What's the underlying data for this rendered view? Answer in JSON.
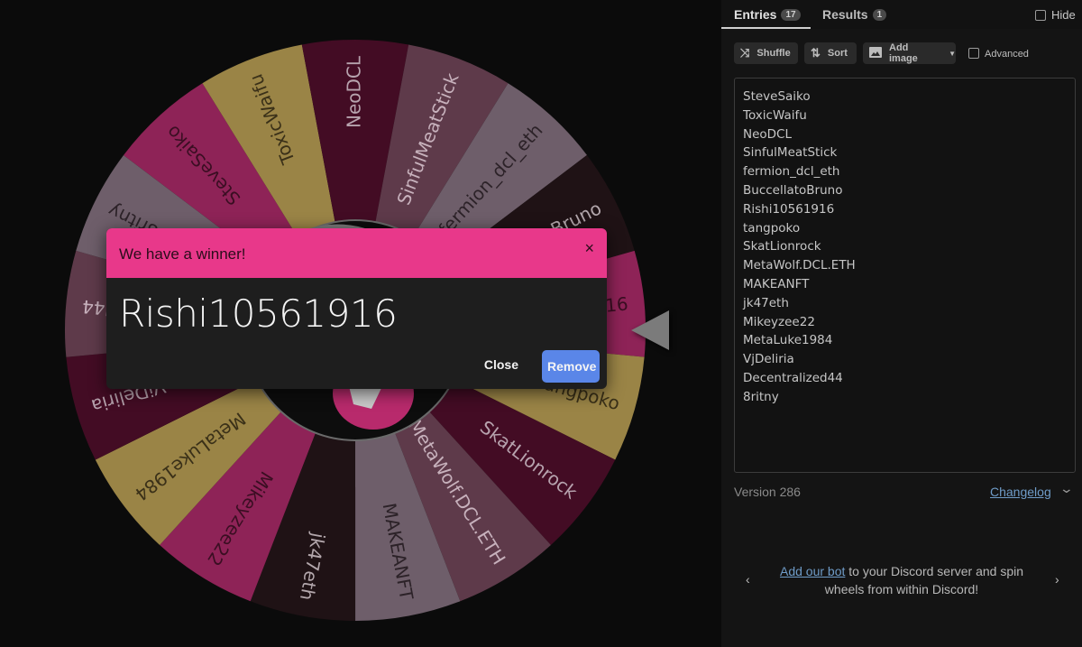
{
  "wheel": {
    "pointer_target": "Rishi10561916",
    "segments": [
      {
        "label": "SteveSaiko",
        "color": "#8e2357",
        "text_color": "#3a0e22"
      },
      {
        "label": "ToxicWaifu",
        "color": "#9a8446",
        "text_color": "#3a3018"
      },
      {
        "label": "NeoDCL",
        "color": "#430c24",
        "text_color": "#b7a3ae"
      },
      {
        "label": "SinfulMeatStick",
        "color": "#5e3a4a",
        "text_color": "#c7b1bc"
      },
      {
        "label": "fermion_dcl_eth",
        "color": "#6e5e6a",
        "text_color": "#2c2228"
      },
      {
        "label": "BuccellatoBruno",
        "color": "#1f1215",
        "text_color": "#b3a7ac"
      },
      {
        "label": "Rishi10561916",
        "color": "#8e2357",
        "text_color": "#3a0e22"
      },
      {
        "label": "tangpoko",
        "color": "#9a8446",
        "text_color": "#3a3018"
      },
      {
        "label": "SkatLionrock",
        "color": "#430c24",
        "text_color": "#b7a3ae"
      },
      {
        "label": "MetaWolf.DCL.ETH",
        "color": "#5e3a4a",
        "text_color": "#c7b1bc"
      },
      {
        "label": "MAKEANFT",
        "color": "#6e5e6a",
        "text_color": "#2c2228"
      },
      {
        "label": "jk47eth",
        "color": "#1f1215",
        "text_color": "#b3a7ac"
      },
      {
        "label": "Mikeyzee22",
        "color": "#8e2357",
        "text_color": "#3a0e22"
      },
      {
        "label": "MetaLuke1984",
        "color": "#9a8446",
        "text_color": "#3a3018"
      },
      {
        "label": "VjDeliria",
        "color": "#430c24",
        "text_color": "#b7a3ae"
      },
      {
        "label": "Decentralized44",
        "color": "#5e3a4a",
        "text_color": "#c7b1bc"
      },
      {
        "label": "8ritny",
        "color": "#6e5e6a",
        "text_color": "#2c2228"
      }
    ],
    "hub_color": "#0d0d0d",
    "hub_accent": "#b82a6c",
    "pointer_color": "#7b7b7b"
  },
  "dialog": {
    "title": "We have a winner!",
    "close_icon": "×",
    "winner": "Rishi10561916",
    "close_label": "Close",
    "remove_label": "Remove",
    "header_color": "#e8388a",
    "remove_color": "#5a86e8"
  },
  "panel": {
    "tabs": [
      {
        "label": "Entries",
        "count": "17",
        "active": true
      },
      {
        "label": "Results",
        "count": "1",
        "active": false
      }
    ],
    "hide_label": "Hide",
    "toolbar": {
      "shuffle_label": "Shuffle",
      "shuffle_icon": "⤨",
      "sort_label": "Sort",
      "sort_icon": "⇅",
      "add_image_label": "Add image",
      "add_image_icon": "🖼",
      "add_image_caret": "▼",
      "advanced_label": "Advanced"
    },
    "entries": [
      "SteveSaiko",
      "ToxicWaifu",
      "NeoDCL",
      "SinfulMeatStick",
      "fermion_dcl_eth",
      "BuccellatoBruno",
      "Rishi10561916",
      "tangpoko",
      "SkatLionrock",
      "MetaWolf.DCL.ETH",
      "MAKEANFT",
      "jk47eth",
      "Mikeyzee22",
      "MetaLuke1984",
      "VjDeliria",
      "Decentralized44",
      "8ritny"
    ],
    "version": "Version 286",
    "changelog_label": "Changelog",
    "expand_icon": "⌄",
    "promo": {
      "link_text": "Add our bot",
      "rest_text": " to your Discord server and spin wheels from within Discord!",
      "prev_icon": "‹",
      "next_icon": "›"
    }
  }
}
